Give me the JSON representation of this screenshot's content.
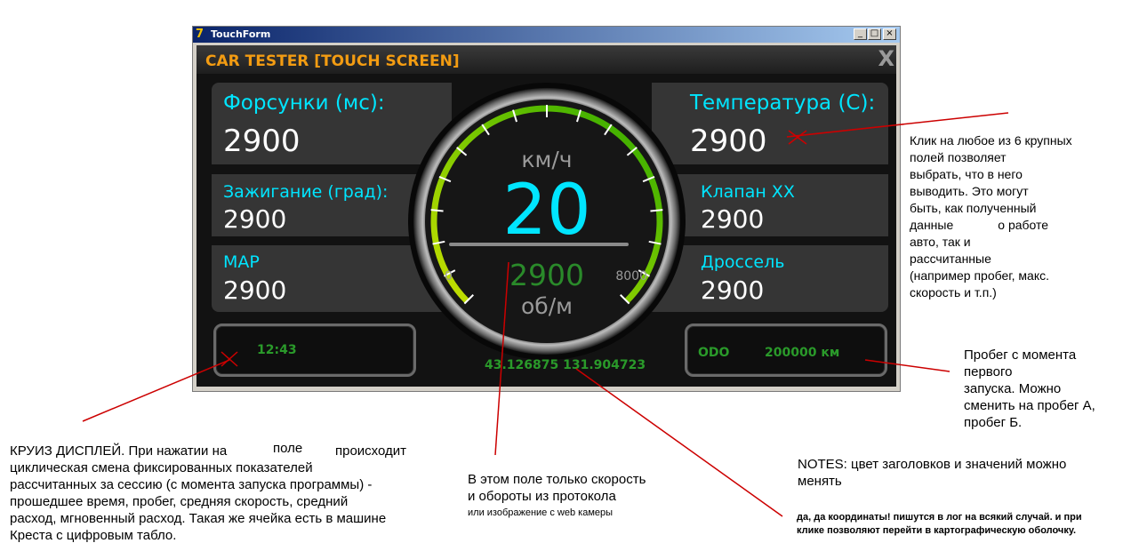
{
  "window": {
    "title": "TouchForm",
    "minimize_glyph": "_",
    "maximize_glyph": "□",
    "close_glyph": "×"
  },
  "app": {
    "title": "CAR TESTER [TOUCH SCREEN]",
    "close_glyph": "X"
  },
  "fields": {
    "injectors": {
      "label": "Форсунки (мс):",
      "value": "2900"
    },
    "temperature": {
      "label": "Температура (С):",
      "value": "2900"
    },
    "ignition": {
      "label": "Зажигание (град):",
      "value": "2900"
    },
    "valve": {
      "label": "Клапан ХХ",
      "value": "2900"
    },
    "map": {
      "label": "MAP",
      "value": "2900"
    },
    "throttle": {
      "label": "Дроссель",
      "value": "2900"
    }
  },
  "gauge": {
    "speed_unit": "км/ч",
    "speed": "20",
    "rpm": "2900",
    "rpm_unit": "об/м",
    "rpm_min": "0",
    "rpm_max": "8000",
    "rpm_fraction": 0.5
  },
  "cruise": {
    "time": "12:43"
  },
  "odo": {
    "label": "ODO",
    "value": "200000 км"
  },
  "coordinates": "43.126875 131.904723",
  "notes": {
    "fields_note": [
      "Клик на любое из 6  крупных",
      "полей позволяет",
      "выбрать, что в него",
      "выводить. Это могут",
      "быть, как полученный",
      "данные",
      "о работе",
      "авто, так и",
      "рассчитанные",
      "(например пробег, макс.",
      "скорость и т.п.)"
    ],
    "odo_note": [
      "Пробег с момента",
      "первого",
      "запуска. Можно",
      "сменить на пробег А,",
      "пробег Б."
    ],
    "cruise_note_1": "КРУИЗ ДИСПЛЕЙ. При нажатии на",
    "cruise_note_pole": "поле",
    "cruise_note_2": "происходит",
    "cruise_note_rest": [
      "циклическая смена фиксированных показателей",
      "рассчитанных за сессию (с момента запуска программы) -",
      "прошедшее время, пробег, средняя скорость, средний",
      "расход, мгновенный расход. Такая же ячейка есть в машине",
      "Креста с цифровым табло."
    ],
    "center_note": [
      "В этом поле только скорость",
      "и обороты из протокола"
    ],
    "center_note_small": "или изображение с web камеры",
    "color_note": [
      "NOTES: цвет заголовков и значений можно",
      "менять"
    ],
    "coords_note": [
      "да, да координаты! пишутся в лог на всякий случай. и при",
      "клике позволяют перейти в картографическую оболочку."
    ]
  }
}
